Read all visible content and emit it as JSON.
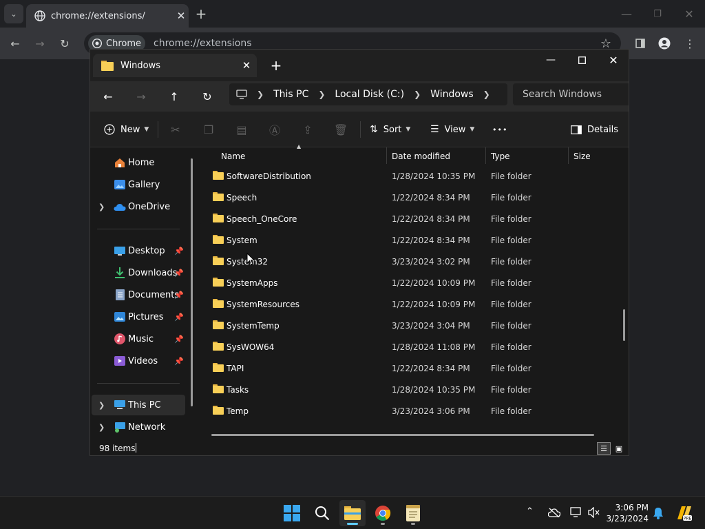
{
  "chrome": {
    "tab_title": "chrome://extensions/",
    "chip_label": "Chrome",
    "url": "chrome://extensions",
    "new_tab": "+",
    "tab_close": "✕"
  },
  "explorer": {
    "tab_title": "Windows",
    "tab_close": "✕",
    "new_tab": "+",
    "breadcrumb": [
      "This PC",
      "Local Disk (C:)",
      "Windows"
    ],
    "search_placeholder": "Search Windows",
    "commands": {
      "new": "New",
      "sort": "Sort",
      "view": "View",
      "more": "•••",
      "details": "Details"
    },
    "nav": {
      "top": [
        {
          "label": "Home",
          "icon": "home-icon"
        },
        {
          "label": "Gallery",
          "icon": "gallery-icon"
        },
        {
          "label": "OneDrive",
          "icon": "onedrive-icon"
        }
      ],
      "quick": [
        {
          "label": "Desktop",
          "icon": "desktop-icon"
        },
        {
          "label": "Downloads",
          "icon": "downloads-icon"
        },
        {
          "label": "Documents",
          "icon": "documents-icon"
        },
        {
          "label": "Pictures",
          "icon": "pictures-icon"
        },
        {
          "label": "Music",
          "icon": "music-icon"
        },
        {
          "label": "Videos",
          "icon": "videos-icon"
        }
      ],
      "bottom": [
        {
          "label": "This PC",
          "icon": "this-pc-icon"
        },
        {
          "label": "Network",
          "icon": "network-icon"
        }
      ]
    },
    "columns": [
      "Name",
      "Date modified",
      "Type",
      "Size"
    ],
    "rows": [
      {
        "name": "SoftwareDistribution",
        "date": "1/28/2024 10:35 PM",
        "type": "File folder"
      },
      {
        "name": "Speech",
        "date": "1/22/2024 8:34 PM",
        "type": "File folder"
      },
      {
        "name": "Speech_OneCore",
        "date": "1/22/2024 8:34 PM",
        "type": "File folder"
      },
      {
        "name": "System",
        "date": "1/22/2024 8:34 PM",
        "type": "File folder"
      },
      {
        "name": "System32",
        "date": "3/23/2024 3:02 PM",
        "type": "File folder"
      },
      {
        "name": "SystemApps",
        "date": "1/22/2024 10:09 PM",
        "type": "File folder"
      },
      {
        "name": "SystemResources",
        "date": "1/22/2024 10:09 PM",
        "type": "File folder"
      },
      {
        "name": "SystemTemp",
        "date": "3/23/2024 3:04 PM",
        "type": "File folder"
      },
      {
        "name": "SysWOW64",
        "date": "1/28/2024 11:08 PM",
        "type": "File folder"
      },
      {
        "name": "TAPI",
        "date": "1/22/2024 8:34 PM",
        "type": "File folder"
      },
      {
        "name": "Tasks",
        "date": "1/28/2024 10:35 PM",
        "type": "File folder"
      },
      {
        "name": "Temp",
        "date": "3/23/2024 3:06 PM",
        "type": "File folder"
      }
    ],
    "status": "98 items"
  },
  "taskbar": {
    "time": "3:06 PM",
    "date": "3/23/2024",
    "accent": "#60cdff"
  }
}
